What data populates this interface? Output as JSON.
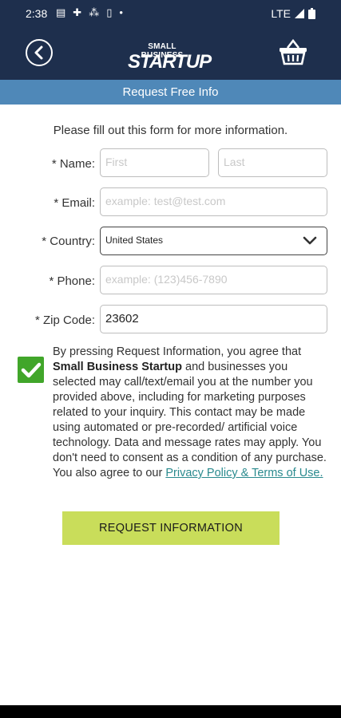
{
  "status_bar": {
    "time": "2:38",
    "network": "LTE"
  },
  "app_bar": {
    "logo_small": "SMALL BUSINESS",
    "logo_big": "STARTUP",
    "icons": [
      "back-icon",
      "basket-icon"
    ]
  },
  "sub_header": {
    "title": "Request Free Info"
  },
  "form": {
    "intro": "Please fill out this form for more information.",
    "name_label": "* Name:",
    "first_placeholder": "First",
    "last_placeholder": "Last",
    "email_label": "* Email:",
    "email_placeholder": "example: test@test.com",
    "country_label": "* Country:",
    "country_value": "United States",
    "phone_label": "* Phone:",
    "phone_placeholder": "example: (123)456-7890",
    "zip_label": "* Zip Code:",
    "zip_value": "23602"
  },
  "consent": {
    "checked": true,
    "text_before": "By pressing Request Information, you agree that",
    "company": "Small Business Startup",
    "text_after": "and businesses you selected may call/text/email you at the number you provided above, including for marketing purposes related to your inquiry. This contact may be made using automated or pre-recorded/ artificial voice technology. Data and message rates may apply. You don't need to consent as a condition of any purchase. You also agree to our",
    "link": "Privacy Policy & Terms of Use."
  },
  "submit_button": {
    "label": "REQUEST INFORMATION"
  },
  "colors": {
    "header": "#1e2f4d",
    "subheader": "#4f88b8",
    "checkbox": "#41a62a",
    "button": "#c9dd5a",
    "link": "#2a8a8e"
  }
}
